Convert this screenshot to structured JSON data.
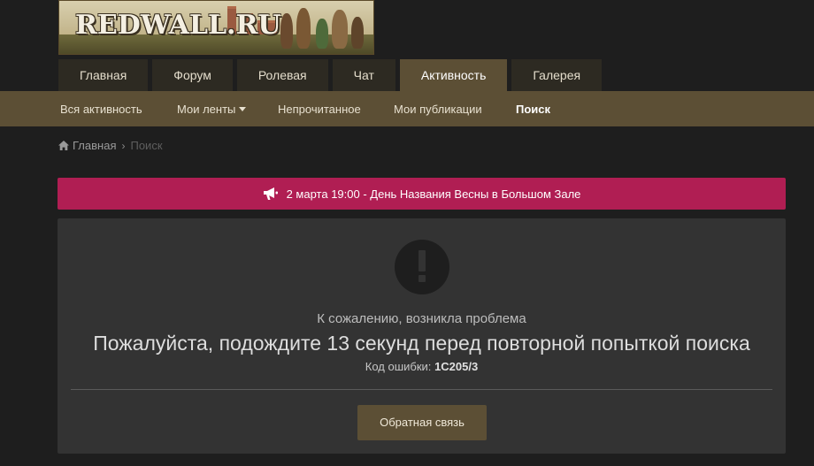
{
  "logo": {
    "text": "REDWALL.RU"
  },
  "main_nav": {
    "tabs": [
      {
        "label": "Главная"
      },
      {
        "label": "Форум"
      },
      {
        "label": "Ролевая"
      },
      {
        "label": "Чат"
      },
      {
        "label": "Активность",
        "active": true
      },
      {
        "label": "Галерея"
      }
    ]
  },
  "sub_nav": {
    "items": [
      {
        "label": "Вся активность"
      },
      {
        "label": "Мои ленты",
        "has_dropdown": true
      },
      {
        "label": "Непрочитанное"
      },
      {
        "label": "Мои публикации"
      },
      {
        "label": "Поиск",
        "active": true
      }
    ]
  },
  "breadcrumb": {
    "home_icon": "home-icon",
    "home": "Главная",
    "separator": "›",
    "current": "Поиск"
  },
  "announcement": {
    "icon": "megaphone-icon",
    "text": "2 марта 19:00 - День Названия Весны в Большом Зале",
    "color": "#b01e53"
  },
  "error": {
    "icon": "exclamation-circle-icon",
    "sorry": "К сожалению, возникла проблема",
    "message": "Пожалуйста, подождите 13 секунд перед повторной попыткой поиска",
    "code_label": "Код ошибки:",
    "code": "1C205/3",
    "button": "Обратная связь"
  },
  "colors": {
    "background": "#1e1e1e",
    "accent": "#5c4f35",
    "panel": "#333333"
  }
}
